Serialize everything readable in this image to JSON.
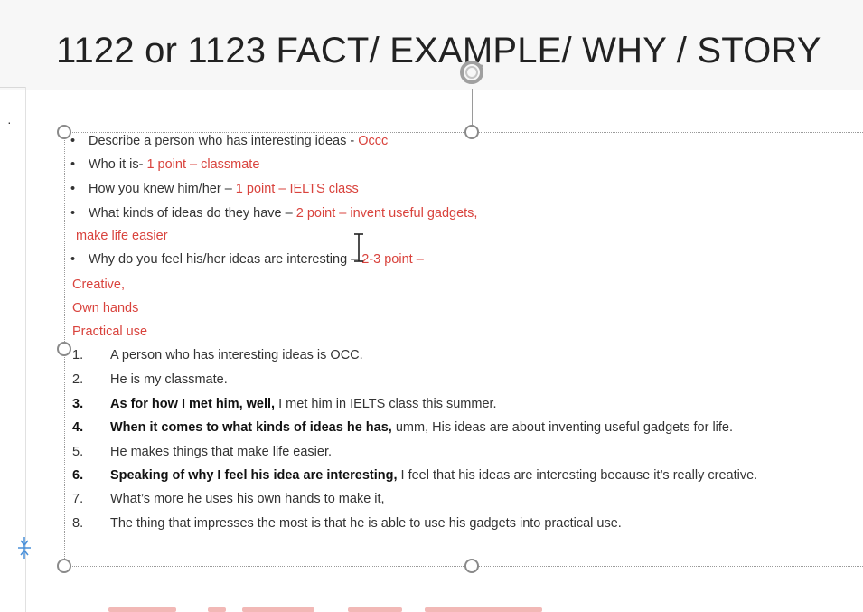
{
  "title": "1122 or 1123  FACT/ EXAMPLE/ WHY / STORY",
  "bullets": [
    {
      "label": "Describe a person who has interesting ideas - ",
      "highlight": "Occc"
    },
    {
      "label": "Who it is- ",
      "highlight": "1 point – classmate"
    },
    {
      "label": "How you knew him/her –  ",
      "highlight": "1 point – IELTS class"
    },
    {
      "label": "What kinds of ideas do they have – ",
      "highlight": "2 point – invent useful gadgets,"
    },
    {
      "label": "",
      "highlight": "make life easier"
    },
    {
      "label": "Why do you feel his/her ideas are interesting –  ",
      "highlight": "2-3 point –"
    }
  ],
  "red_notes": [
    "Creative,",
    "Own hands",
    "Practical use"
  ],
  "numbered": [
    {
      "n": "1.",
      "bold": "",
      "text": "A person who has interesting ideas is OCC."
    },
    {
      "n": "2.",
      "bold": "",
      "text": "He is my classmate."
    },
    {
      "n": "3.",
      "bold": "As for how I met him, well,",
      "text": " I met him in IELTS class this summer."
    },
    {
      "n": "4.",
      "bold": "When it comes to what kinds of ideas he has,",
      "text": " umm,  His ideas are about inventing useful gadgets for life."
    },
    {
      "n": "5.",
      "bold": "",
      "text": " He makes things that make life easier."
    },
    {
      "n": "6.",
      "bold": "Speaking of why I feel his idea are interesting,",
      "text": " I feel that his ideas are interesting because it’s really creative."
    },
    {
      "n": "7.",
      "bold": "",
      "text": " What’s more he uses his own hands to make it,"
    },
    {
      "n": "8.",
      "bold": "",
      "text": " The thing that impresses the most is that he is able to use his gadgets into practical use."
    }
  ],
  "icons": [
    "rotate-handle-icon",
    "text-cursor-icon",
    "collapse-ruler-icon",
    "resize-handle-icon"
  ],
  "colors": {
    "accent_red": "#d9433d",
    "text": "#333333"
  }
}
